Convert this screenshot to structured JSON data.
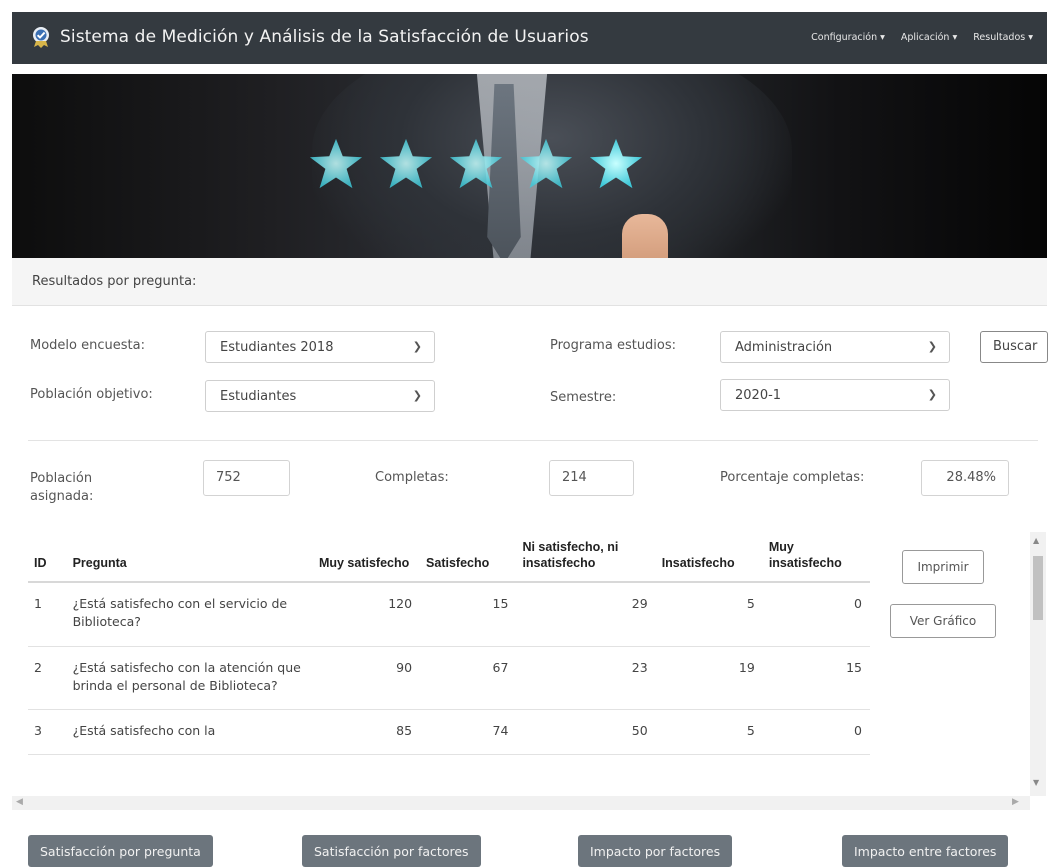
{
  "navbar": {
    "title": "Sistema de Medición y Análisis de la Satisfacción de Usuarios",
    "menu": [
      {
        "label": "Configuración ▾"
      },
      {
        "label": "Aplicación ▾"
      },
      {
        "label": "Resultados ▾"
      }
    ]
  },
  "section": {
    "title": "Resultados por pregunta:"
  },
  "filters": {
    "modelo_label": "Modelo encuesta:",
    "modelo_value": "Estudiantes 2018",
    "poblacion_label": "Población objetivo:",
    "poblacion_value": "Estudiantes",
    "programa_label": "Programa estudios:",
    "programa_value": "Administración",
    "semestre_label": "Semestre:",
    "semestre_value": "2020-1",
    "buscar_label": "Buscar"
  },
  "stats": {
    "asignada_label": "Población asignada:",
    "asignada_value": "752",
    "completas_label": "Completas:",
    "completas_value": "214",
    "porcentaje_label": "Porcentaje completas:",
    "porcentaje_value": "28.48%"
  },
  "table": {
    "headers": {
      "id": "ID",
      "pregunta": "Pregunta",
      "muy_satisfecho": "Muy satisfecho",
      "satisfecho": "Satisfecho",
      "ni": "Ni satisfecho, ni insatisfecho",
      "insatisfecho": "Insatisfecho",
      "muy_insatisfecho": "Muy insatisfecho"
    },
    "rows": [
      {
        "id": "1",
        "pregunta": "¿Está satisfecho con el servicio de Biblioteca?",
        "v1": "120",
        "v2": "15",
        "v3": "29",
        "v4": "5",
        "v5": "0"
      },
      {
        "id": "2",
        "pregunta": "¿Está satisfecho con la atención que brinda el personal de Biblioteca?",
        "v1": "90",
        "v2": "67",
        "v3": "23",
        "v4": "19",
        "v5": "15"
      },
      {
        "id": "3",
        "pregunta": "¿Está satisfecho con la",
        "v1": "85",
        "v2": "74",
        "v3": "50",
        "v4": "5",
        "v5": "0"
      }
    ]
  },
  "side_buttons": {
    "imprimir": "Imprimir",
    "ver_grafico": "Ver Gráfico"
  },
  "bottom_buttons": {
    "b1": "Satisfacción por pregunta",
    "b2": "Satisfacción por factores",
    "b3": "Impacto por factores",
    "b4": "Impacto entre factores"
  }
}
